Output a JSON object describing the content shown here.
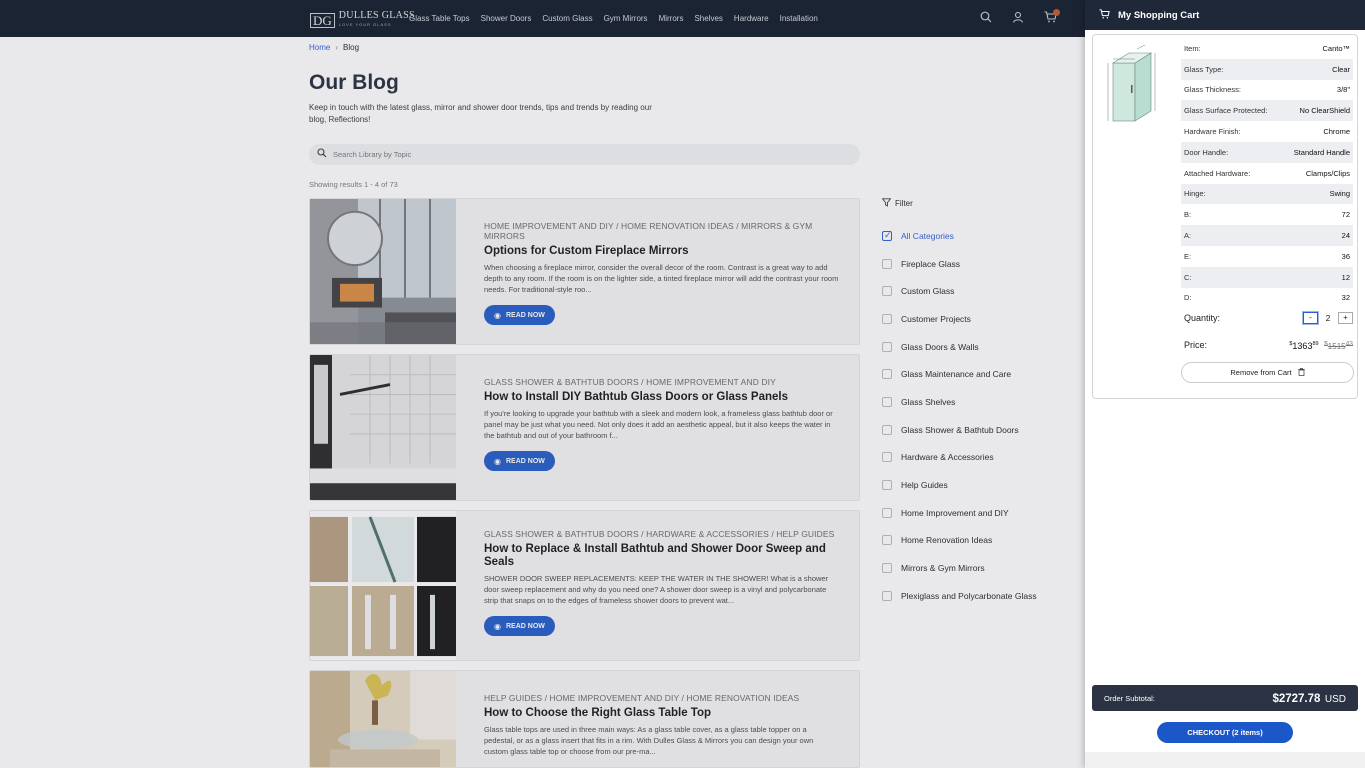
{
  "header": {
    "logo_name": "DULLES GLASS",
    "logo_tagline": "LOVE YOUR GLASS",
    "logo_mark": "DG",
    "nav": [
      "Glass Table Tops",
      "Shower Doors",
      "Custom Glass",
      "Gym Mirrors",
      "Mirrors",
      "Shelves",
      "Hardware",
      "Installation"
    ]
  },
  "breadcrumb": {
    "home": "Home",
    "separator": "›",
    "current": "Blog"
  },
  "page": {
    "title": "Our Blog",
    "intro": "Keep in touch with the latest glass, mirror and shower door trends, tips and trends by reading our blog, Reflections!",
    "search_placeholder": "Search Library by Topic",
    "results": "Showing results 1 - 4 of 73"
  },
  "posts": [
    {
      "categories": "HOME IMPROVEMENT AND DIY / HOME RENOVATION IDEAS / MIRRORS & GYM MIRRORS",
      "title": "Options for Custom Fireplace Mirrors",
      "excerpt": "When choosing a fireplace mirror, consider the overall decor of the room. Contrast is a great way to add depth to any room. If the room is on the lighter side, a tinted fireplace mirror will add the contrast your room needs. For traditional-style roo...",
      "button": "READ NOW"
    },
    {
      "categories": "GLASS SHOWER & BATHTUB DOORS / HOME IMPROVEMENT AND DIY",
      "title": "How to Install DIY Bathtub Glass Doors or Glass Panels",
      "excerpt": "If you're looking to upgrade your bathtub with a sleek and modern look, a frameless glass bathtub door or panel may be just what you need. Not only does it add an aesthetic appeal, but it also keeps the water in the bathtub and out of your bathroom f...",
      "button": "READ NOW"
    },
    {
      "categories": "GLASS SHOWER & BATHTUB DOORS / HARDWARE & ACCESSORIES / HELP GUIDES",
      "title": "How to Replace & Install Bathtub and Shower Door Sweep and Seals",
      "excerpt": "SHOWER DOOR SWEEP REPLACEMENTS: KEEP THE WATER IN THE SHOWER! What is a shower door sweep replacement and why do you need one? A shower door sweep is a vinyl and polycarbonate strip that snaps on to the edges of frameless shower doors to prevent wat...",
      "button": "READ NOW"
    },
    {
      "categories": "HELP GUIDES / HOME IMPROVEMENT AND DIY / HOME RENOVATION IDEAS",
      "title": "How to Choose the Right Glass Table Top",
      "excerpt": "Glass table tops are used in three main ways: As a glass table cover, as a glass table topper on a pedestal, or as a glass insert that fits in a rim. With Dulles Glass & Mirrors you can design your own custom glass table top or choose from our pre-ma...",
      "button": "READ NOW"
    }
  ],
  "filter": {
    "label": "Filter",
    "categories": [
      "All Categories",
      "Fireplace Glass",
      "Custom Glass",
      "Customer Projects",
      "Glass Doors & Walls",
      "Glass Maintenance and Care",
      "Glass Shelves",
      "Glass Shower & Bathtub Doors",
      "Hardware & Accessories",
      "Help Guides",
      "Home Improvement and DIY",
      "Home Renovation Ideas",
      "Mirrors & Gym Mirrors",
      "Plexiglass and Polycarbonate Glass"
    ]
  },
  "cart": {
    "title": "My Shopping Cart",
    "specs": [
      {
        "k": "Item:",
        "v": "Canto™"
      },
      {
        "k": "Glass Type:",
        "v": "Clear"
      },
      {
        "k": "Glass Thickness:",
        "v": "3/8\""
      },
      {
        "k": "Glass Surface Protected:",
        "v": "No ClearShield"
      },
      {
        "k": "Hardware Finish:",
        "v": "Chrome"
      },
      {
        "k": "Door Handle:",
        "v": "Standard Handle"
      },
      {
        "k": "Attached Hardware:",
        "v": "Clamps/Clips"
      },
      {
        "k": "Hinge:",
        "v": "Swing"
      },
      {
        "k": "B:",
        "v": "72"
      },
      {
        "k": "A:",
        "v": "24"
      },
      {
        "k": "E:",
        "v": "36"
      },
      {
        "k": "C:",
        "v": "12"
      },
      {
        "k": "D:",
        "v": "32"
      }
    ],
    "quantity_label": "Quantity:",
    "quantity": "2",
    "minus": "-",
    "plus": "+",
    "price_label": "Price:",
    "price_currency": "$",
    "price_whole": "1363",
    "price_cents": "89",
    "old_currency": "$",
    "old_whole": "1515",
    "old_cents": "43",
    "remove_label": "Remove from Cart",
    "subtotal_label": "Order Subtotal:",
    "subtotal_amount": "$2727.78",
    "subtotal_currency": "USD",
    "checkout_label": "CHECKOUT (2 items)"
  }
}
